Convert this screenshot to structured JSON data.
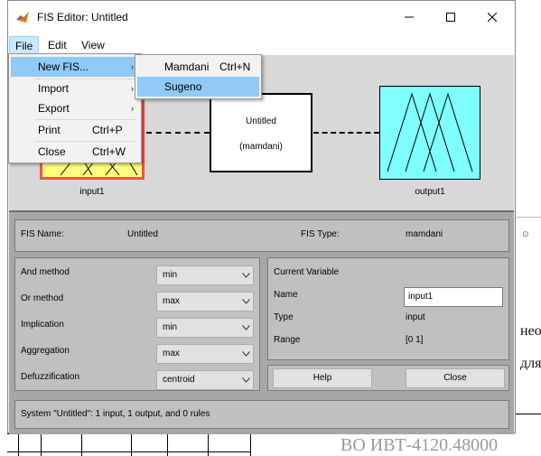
{
  "window": {
    "title": "FIS Editor: Untitled",
    "controls": [
      "minimize",
      "maximize",
      "close"
    ]
  },
  "menubar": {
    "items": [
      "File",
      "Edit",
      "View"
    ]
  },
  "file_menu": {
    "items": [
      {
        "label": "New FIS...",
        "shortcut": "",
        "submenu": true
      },
      {
        "label": "Import",
        "shortcut": "",
        "submenu": true
      },
      {
        "label": "Export",
        "shortcut": "",
        "submenu": true
      },
      {
        "label": "Print",
        "shortcut": "Ctrl+P",
        "submenu": false
      },
      {
        "label": "Close",
        "shortcut": "Ctrl+W",
        "submenu": false
      }
    ]
  },
  "new_fis_submenu": {
    "items": [
      {
        "label": "Mamdani",
        "shortcut": "Ctrl+N"
      },
      {
        "label": "Sugeno",
        "shortcut": ""
      }
    ],
    "highlighted": "Sugeno"
  },
  "diagram": {
    "input_label": "input1",
    "system_name": "Untitled",
    "system_type": "(mamdani)",
    "output_label": "output1",
    "colors": {
      "input": "#ffff7f",
      "output": "#7fffff",
      "input_border": "#ff4d4d"
    }
  },
  "info": {
    "fis_name_label": "FIS Name:",
    "fis_name_value": "Untitled",
    "fis_type_label": "FIS Type:",
    "fis_type_value": "mamdani"
  },
  "methods": {
    "and": {
      "label": "And method",
      "value": "min"
    },
    "or": {
      "label": "Or method",
      "value": "max"
    },
    "implication": {
      "label": "Implication",
      "value": "min"
    },
    "aggregation": {
      "label": "Aggregation",
      "value": "max"
    },
    "defuzz": {
      "label": "Defuzzification",
      "value": "centroid"
    }
  },
  "current_variable": {
    "title": "Current Variable",
    "name_label": "Name",
    "name_value": "input1",
    "type_label": "Type",
    "type_value": "input",
    "range_label": "Range",
    "range_value": "[0 1]"
  },
  "buttons": {
    "help": "Help",
    "close": "Close"
  },
  "status": "System \"Untitled\": 1 input, 1 output, and 0 rules",
  "background_doc": {
    "right_text_1": "нео",
    "right_text_2": "для",
    "bottom_text": "ВО ИВТ-4120.48000"
  }
}
